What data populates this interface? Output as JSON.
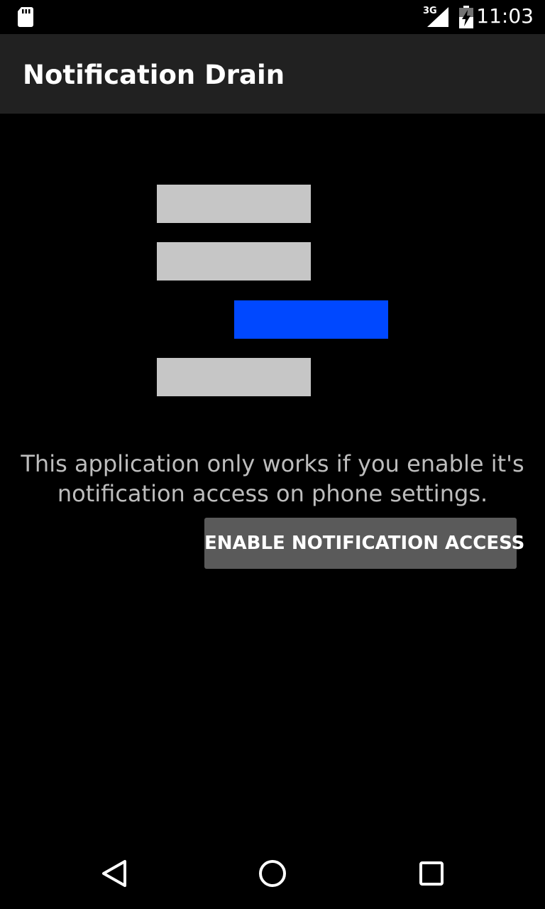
{
  "status_bar": {
    "time": "11:03",
    "network_type": "3G",
    "icons": [
      "sd-card-icon",
      "signal-icon",
      "battery-charging-icon"
    ]
  },
  "app_bar": {
    "title": "Notification Drain"
  },
  "logo": {
    "bars": [
      {
        "color": "#c6c6c6"
      },
      {
        "color": "#c6c6c6"
      },
      {
        "color": "#0048ff"
      },
      {
        "color": "#c6c6c6"
      }
    ]
  },
  "main": {
    "message": "This application only works if you enable it's notification access on phone settings.",
    "button_label": "ENABLE NOTIFICATION ACCESS"
  },
  "nav_bar": {
    "icons": [
      "back-icon",
      "home-icon",
      "recents-icon"
    ]
  },
  "colors": {
    "background": "#000000",
    "app_bar": "#212121",
    "button": "#5a5a5a",
    "accent": "#0048ff",
    "text_secondary": "#bdbdbd"
  }
}
